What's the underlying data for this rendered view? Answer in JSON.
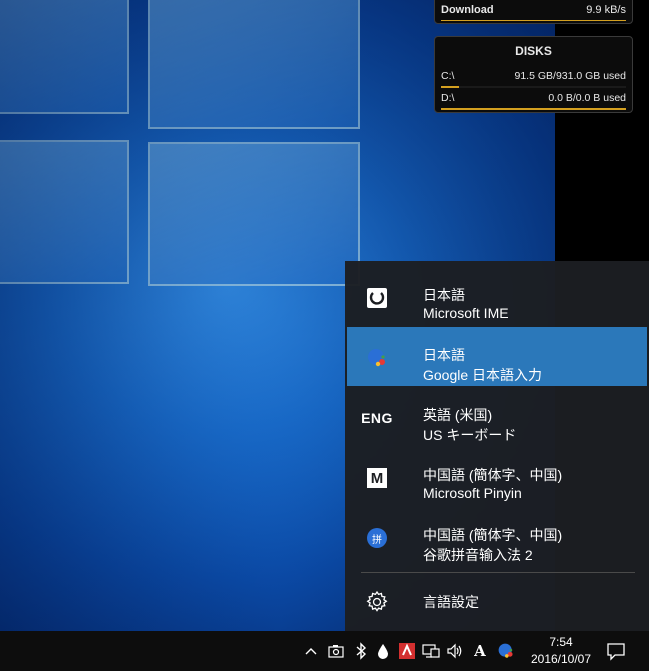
{
  "network_widget": {
    "label": "Download",
    "value": "9.9 kB/s"
  },
  "disks_widget": {
    "title": "DISKS",
    "drives": [
      {
        "name": "C:\\",
        "usage": "91.5 GB/931.0 GB used",
        "fraction": 0.098
      },
      {
        "name": "D:\\",
        "usage": "0.0 B/0.0 B used",
        "fraction": 1.0
      }
    ]
  },
  "language_flyout": {
    "items": [
      {
        "name": "日本語",
        "sub": "Microsoft IME",
        "icon": "microsoft-ime-icon",
        "selected": false
      },
      {
        "name": "日本語",
        "sub": "Google 日本語入力",
        "icon": "google-ime-icon",
        "selected": true
      },
      {
        "name": "英語 (米国)",
        "sub": "US キーボード",
        "icon": "eng-icon",
        "icon_text": "ENG",
        "selected": false
      },
      {
        "name": "中国語 (簡体字、中国)",
        "sub": "Microsoft Pinyin",
        "icon": "microsoft-pinyin-icon",
        "icon_text": "M",
        "selected": false
      },
      {
        "name": "中国語 (簡体字、中国)",
        "sub": "谷歌拼音输入法 2",
        "icon": "google-pinyin-icon",
        "icon_text": "拼",
        "selected": false
      }
    ],
    "settings_label": "言語設定"
  },
  "taskbar": {
    "ime_mode": "A",
    "time": "7:54",
    "date": "2016/10/07"
  },
  "colors": {
    "selected": "#2b78ba",
    "flyout_bg": "#1c1e22",
    "disk_bar": "#d4a020"
  }
}
